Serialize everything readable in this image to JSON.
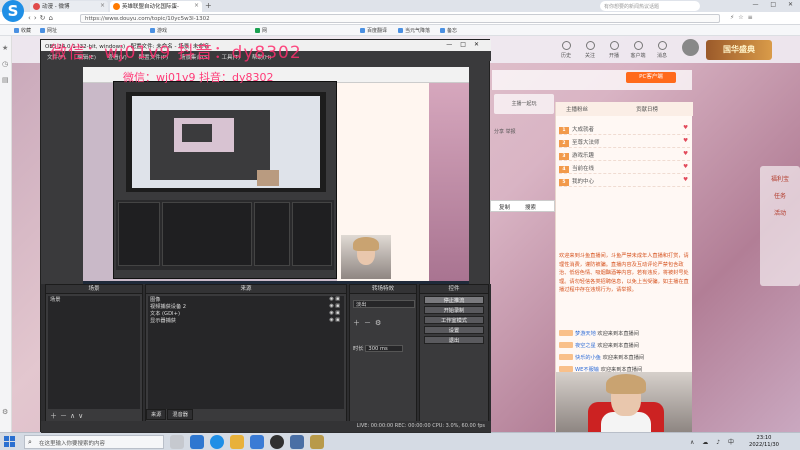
{
  "browser": {
    "tabs": [
      {
        "label": "动漫 - 微博"
      },
      {
        "label": "英雄联盟自动化国际蛋-"
      }
    ],
    "new_tab": "+",
    "search_placeholder": "有你想要的新闻热议话题",
    "url": "https://www.douyu.com/topic/10yc5w3l-1302",
    "bookmarks": [
      "收藏",
      "网址",
      "游戏",
      "网",
      "百度翻译",
      "当元气降落",
      "备忘"
    ],
    "window_controls": "— □ ✕"
  },
  "douyu": {
    "top_nav": [
      "历史",
      "关注",
      "开播",
      "客户端",
      "消息"
    ],
    "banner": "国华盛典",
    "pc_button": "PC客户端",
    "follow_hint": "主播一起玩",
    "share_hint": "分享  举报",
    "chat_tabs": [
      "主播粉丝",
      "贡献日榜"
    ],
    "rank_rows": [
      "大成就者",
      "至尊大法师",
      "游戏乐趣",
      "当前在线",
      "我的中心"
    ],
    "notice": "欢迎来到斗鱼直播间，斗鱼严禁未成年人直播和打赏，请理性消费，谨防被骗。直播内容及互动评论严禁包含政治、低俗色情、吸烟酗酒等内容，若有违反，将被封号处理。请勿轻信各类招聘信息，以免上当受骗，如主播在直播过程中存在违规行为，请举报。",
    "chat_messages": [
      {
        "name": "梦游天地",
        "text": "欢迎来到本直播间"
      },
      {
        "name": "夜空之星",
        "text": "欢迎来到本直播间"
      },
      {
        "name": "快乐的小鱼",
        "text": "欢迎来到本直播间"
      },
      {
        "name": "WE不服输",
        "text": "欢迎来到本直播间"
      }
    ],
    "popup": [
      "复制",
      "搜索"
    ],
    "side_items": [
      "福利宝",
      "任务",
      "活动"
    ],
    "watermark": "微信：wj01v9 抖音：dy8302"
  },
  "obs": {
    "title": "OBS 24.0.1 (32-bit, windows) - 配置文件: 未命名 - 场景: 未命名",
    "menu": [
      "文件(F)",
      "编辑(E)",
      "查看(V)",
      "配置文件(P)",
      "场景集合(S)",
      "工具(T)",
      "帮助(H)"
    ],
    "docks": {
      "scenes": {
        "title": "场景",
        "items": [
          "场景"
        ]
      },
      "sources": {
        "title": "来源",
        "items": [
          "图像",
          "视频捕获设备 2",
          "文本 (GDI+)",
          "显示器捕获"
        ]
      },
      "mixer": {
        "title": "转场特效",
        "select": "淡出",
        "duration_label": "时长",
        "duration": "300 ms"
      },
      "controls": {
        "title": "控件",
        "buttons": [
          "停止推流",
          "开始录制",
          "工作室模式",
          "设置",
          "退出"
        ]
      }
    },
    "bottom_tabs": [
      "来源",
      "混音器"
    ],
    "status": "LIVE: 00:00:00   REC: 00:00:00   CPU: 3.0%, 60.00 fps"
  },
  "taskbar": {
    "search_placeholder": "在这里输入你要搜索的内容",
    "tray": "∧ ☁ ♪ 中",
    "time": "23:10",
    "date": "2022/11/30"
  }
}
